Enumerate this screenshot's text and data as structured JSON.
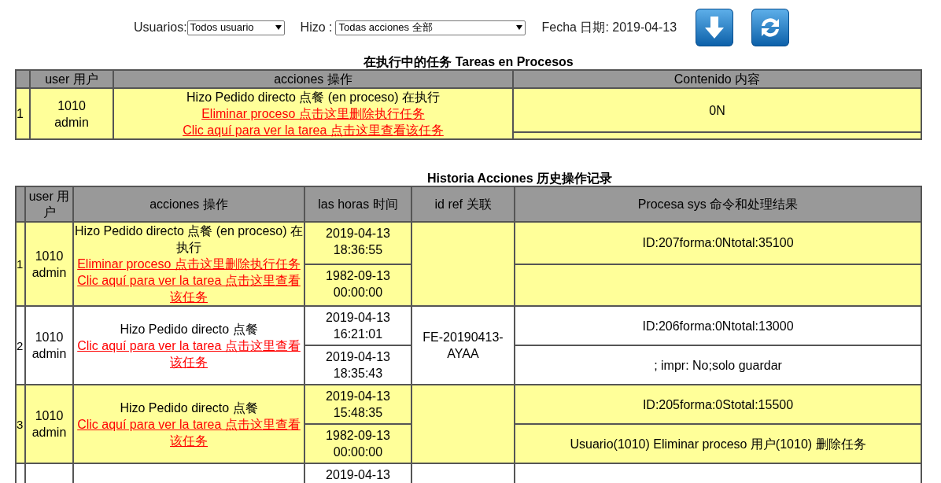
{
  "filters": {
    "users": {
      "label": "Usuarios:",
      "value": "Todos usuario"
    },
    "actions": {
      "label": "Hizo :",
      "value": "Todas acciones 全部"
    },
    "date": "Fecha 日期: 2019-04-13"
  },
  "toolbar_buttons": [
    {
      "kind": "download"
    },
    {
      "kind": "refresh"
    }
  ],
  "running_tasks": {
    "title": "在执行中的任务 Tareas en Procesos",
    "columns": [
      "user 用户",
      "acciones 操作",
      "Contenido 内容"
    ],
    "rows": [
      {
        "index": "1",
        "user_id": "1010",
        "user_name": "admin",
        "action": "Hizo Pedido directo 点餐 (en proceso) 在执行",
        "links": [
          "Eliminar proceso 点击这里删除执行任务",
          "Clic aquí para ver la tarea 点击这里查看该任务"
        ],
        "content": "0N",
        "highlighted": true
      }
    ]
  },
  "history": {
    "title": "Historia Acciones 历史操作记录",
    "columns": [
      "user 用户",
      "acciones 操作",
      "las horas 时间",
      "id ref 关联",
      "Procesa sys 命令和处理结果"
    ],
    "rows": [
      {
        "index": "1",
        "user_id": "1010",
        "user_name": "admin",
        "action": "Hizo Pedido directo 点餐 (en proceso) 在执行",
        "links": [
          "Eliminar proceso 点击这里删除执行任务",
          "Clic aquí para ver la tarea 点击这里查看该任务"
        ],
        "entries": [
          {
            "time": "2019-04-13 18:36:55",
            "result": "ID:207forma:0Ntotal:35100"
          },
          {
            "time": "1982-09-13 00:00:00"
          }
        ],
        "highlighted": true
      },
      {
        "index": "2",
        "user_id": "1010",
        "user_name": "admin",
        "action": "Hizo Pedido directo 点餐",
        "links": [
          "Clic aquí para ver la tarea 点击这里查看该任务"
        ],
        "entries": [
          {
            "time": "2019-04-13 16:21:01",
            "result": "ID:206forma:0Ntotal:13000"
          },
          {
            "time": "2019-04-13 18:35:43",
            "result": "; impr: No;solo guardar"
          }
        ],
        "id_ref": "FE-20190413-AYAA",
        "highlighted": false
      },
      {
        "index": "3",
        "user_id": "1010",
        "user_name": "admin",
        "action": "Hizo Pedido directo 点餐",
        "links": [
          "Clic aquí para ver la tarea 点击这里查看该任务"
        ],
        "entries": [
          {
            "time": "2019-04-13 15:48:35",
            "result": "ID:205forma:0Stotal:15500"
          },
          {
            "time": "1982-09-13 00:00:00",
            "result": "Usuario(1010) Eliminar proceso 用户(1010) 删除任务"
          }
        ],
        "highlighted": true
      },
      {
        "entries": [
          {
            "time": "2019-04-13"
          }
        ],
        "highlighted": false
      }
    ]
  }
}
